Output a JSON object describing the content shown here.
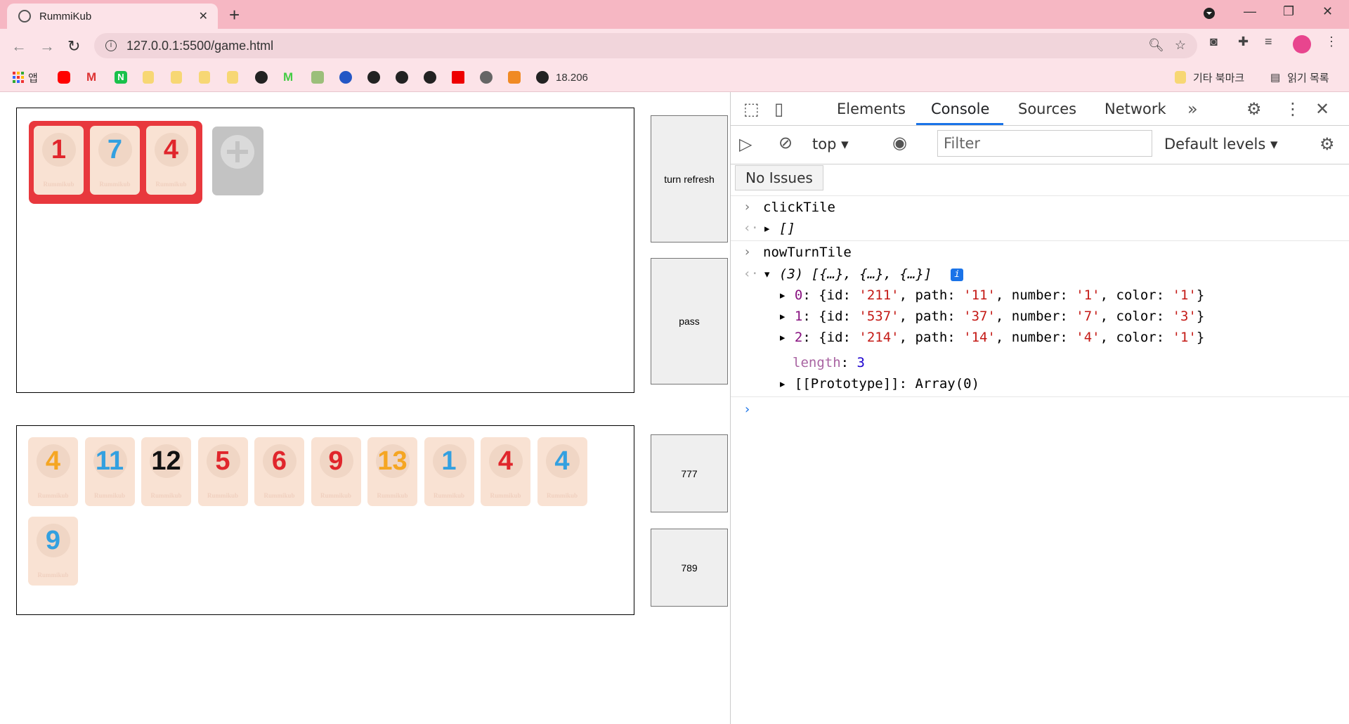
{
  "browser": {
    "tab_title": "RummiKub",
    "url": "127.0.0.1:5500/game.html",
    "bookmarks": [
      {
        "label": "앱",
        "icon": "apps-icon"
      },
      {
        "label": "",
        "icon": "youtube-icon"
      },
      {
        "label": "",
        "icon": "gmail-icon"
      },
      {
        "label": "",
        "icon": "naver-icon"
      },
      {
        "label": "",
        "icon": "folder-icon"
      },
      {
        "label": "",
        "icon": "folder-icon"
      },
      {
        "label": "",
        "icon": "folder-icon"
      },
      {
        "label": "",
        "icon": "folder-icon"
      },
      {
        "label": "",
        "icon": "github-icon"
      },
      {
        "label": "",
        "icon": "m-icon"
      },
      {
        "label": "",
        "icon": "building-icon"
      },
      {
        "label": "",
        "icon": "blue-swirl-icon"
      },
      {
        "label": "",
        "icon": "globe-icon"
      },
      {
        "label": "",
        "icon": "globe-icon"
      },
      {
        "label": "",
        "icon": "globe-icon"
      },
      {
        "label": "",
        "icon": "now-icon"
      },
      {
        "label": "",
        "icon": "steam-icon"
      },
      {
        "label": "",
        "icon": "box-icon"
      },
      {
        "label": "18.206",
        "icon": "globe-icon"
      }
    ],
    "other_bookmarks": "기타 북마크",
    "reading_list": "읽기 목록"
  },
  "game": {
    "board_group": [
      {
        "number": "1",
        "color": "#e0262c"
      },
      {
        "number": "7",
        "color": "#33a0e0"
      },
      {
        "number": "4",
        "color": "#e0262c"
      }
    ],
    "rack": [
      {
        "number": "4",
        "color": "#f5a623"
      },
      {
        "number": "11",
        "color": "#33a0e0"
      },
      {
        "number": "12",
        "color": "#111111"
      },
      {
        "number": "5",
        "color": "#e0262c"
      },
      {
        "number": "6",
        "color": "#e0262c"
      },
      {
        "number": "9",
        "color": "#e0262c"
      },
      {
        "number": "13",
        "color": "#f5a623"
      },
      {
        "number": "1",
        "color": "#33a0e0"
      },
      {
        "number": "4",
        "color": "#e0262c"
      },
      {
        "number": "4",
        "color": "#33a0e0"
      },
      {
        "number": "9",
        "color": "#33a0e0"
      }
    ],
    "tile_brand": "Rummikub",
    "buttons": {
      "turn_refresh": "turn refresh",
      "pass": "pass",
      "b777": "777",
      "b789": "789"
    }
  },
  "devtools": {
    "tabs": [
      "Elements",
      "Console",
      "Sources",
      "Network"
    ],
    "active_tab": "Console",
    "context": "top",
    "filter_placeholder": "Filter",
    "levels": "Default levels",
    "issues": "No Issues",
    "console": {
      "cmd1": "clickTile",
      "res1": "[]",
      "cmd2": "nowTurnTile",
      "res2_summary": "(3) [{…}, {…}, {…}]",
      "rows": [
        {
          "index": "0",
          "id": "'211'",
          "path": "'11'",
          "number": "'1'",
          "color": "'1'"
        },
        {
          "index": "1",
          "id": "'537'",
          "path": "'37'",
          "number": "'7'",
          "color": "'3'"
        },
        {
          "index": "2",
          "id": "'214'",
          "path": "'14'",
          "number": "'4'",
          "color": "'1'"
        }
      ],
      "length_label": "length",
      "length_value": "3",
      "prototype_label": "[[Prototype]]",
      "prototype_value": "Array(0)"
    }
  }
}
